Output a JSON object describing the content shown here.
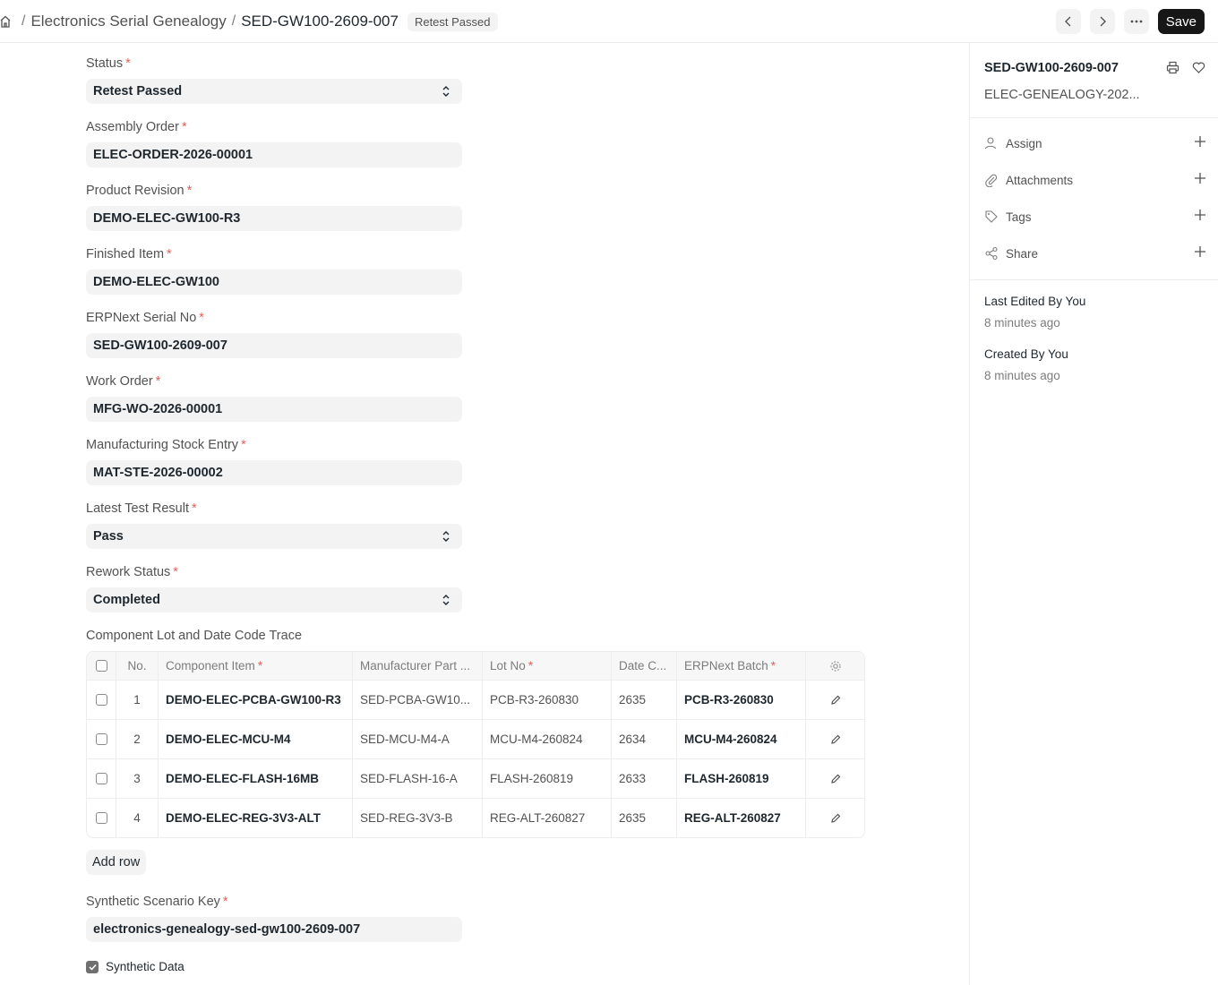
{
  "header": {
    "breadcrumb_parent": "Electronics Serial Genealogy",
    "breadcrumb_current": "SED-GW100-2609-007",
    "status_badge": "Retest Passed",
    "save_label": "Save"
  },
  "form": {
    "fields": [
      {
        "label": "Status",
        "value": "Retest Passed",
        "type": "select"
      },
      {
        "label": "Assembly Order",
        "value": "ELEC-ORDER-2026-00001",
        "type": "link"
      },
      {
        "label": "Product Revision",
        "value": "DEMO-ELEC-GW100-R3",
        "type": "link"
      },
      {
        "label": "Finished Item",
        "value": "DEMO-ELEC-GW100",
        "type": "link"
      },
      {
        "label": "ERPNext Serial No",
        "value": "SED-GW100-2609-007",
        "type": "link"
      },
      {
        "label": "Work Order",
        "value": "MFG-WO-2026-00001",
        "type": "link"
      },
      {
        "label": "Manufacturing Stock Entry",
        "value": "MAT-STE-2026-00002",
        "type": "link"
      },
      {
        "label": "Latest Test Result",
        "value": "Pass",
        "type": "select"
      },
      {
        "label": "Rework Status",
        "value": "Completed",
        "type": "select"
      }
    ],
    "table_label": "Component Lot and Date Code Trace",
    "table_headers": [
      "No.",
      "Component Item",
      "Manufacturer Part ...",
      "Lot No",
      "Date C...",
      "ERPNext Batch"
    ],
    "table_rows": [
      {
        "no": "1",
        "item": "DEMO-ELEC-PCBA-GW100-R3",
        "mpn": "SED-PCBA-GW10...",
        "lot": "PCB-R3-260830",
        "date": "2635",
        "batch": "PCB-R3-260830"
      },
      {
        "no": "2",
        "item": "DEMO-ELEC-MCU-M4",
        "mpn": "SED-MCU-M4-A",
        "lot": "MCU-M4-260824",
        "date": "2634",
        "batch": "MCU-M4-260824"
      },
      {
        "no": "3",
        "item": "DEMO-ELEC-FLASH-16MB",
        "mpn": "SED-FLASH-16-A",
        "lot": "FLASH-260819",
        "date": "2633",
        "batch": "FLASH-260819"
      },
      {
        "no": "4",
        "item": "DEMO-ELEC-REG-3V3-ALT",
        "mpn": "SED-REG-3V3-B",
        "lot": "REG-ALT-260827",
        "date": "2635",
        "batch": "REG-ALT-260827"
      }
    ],
    "add_row_label": "Add row",
    "scenario_label": "Synthetic Scenario Key",
    "scenario_value": "electronics-genealogy-sed-gw100-2609-007",
    "synthetic_label": "Synthetic Data"
  },
  "sidebar": {
    "title": "SED-GW100-2609-007",
    "subtitle": "ELEC-GENEALOGY-202...",
    "actions": [
      "Assign",
      "Attachments",
      "Tags",
      "Share"
    ],
    "last_edited": "Last Edited By You",
    "last_edited_time": "8 minutes ago",
    "created": "Created By You",
    "created_time": "8 minutes ago"
  }
}
